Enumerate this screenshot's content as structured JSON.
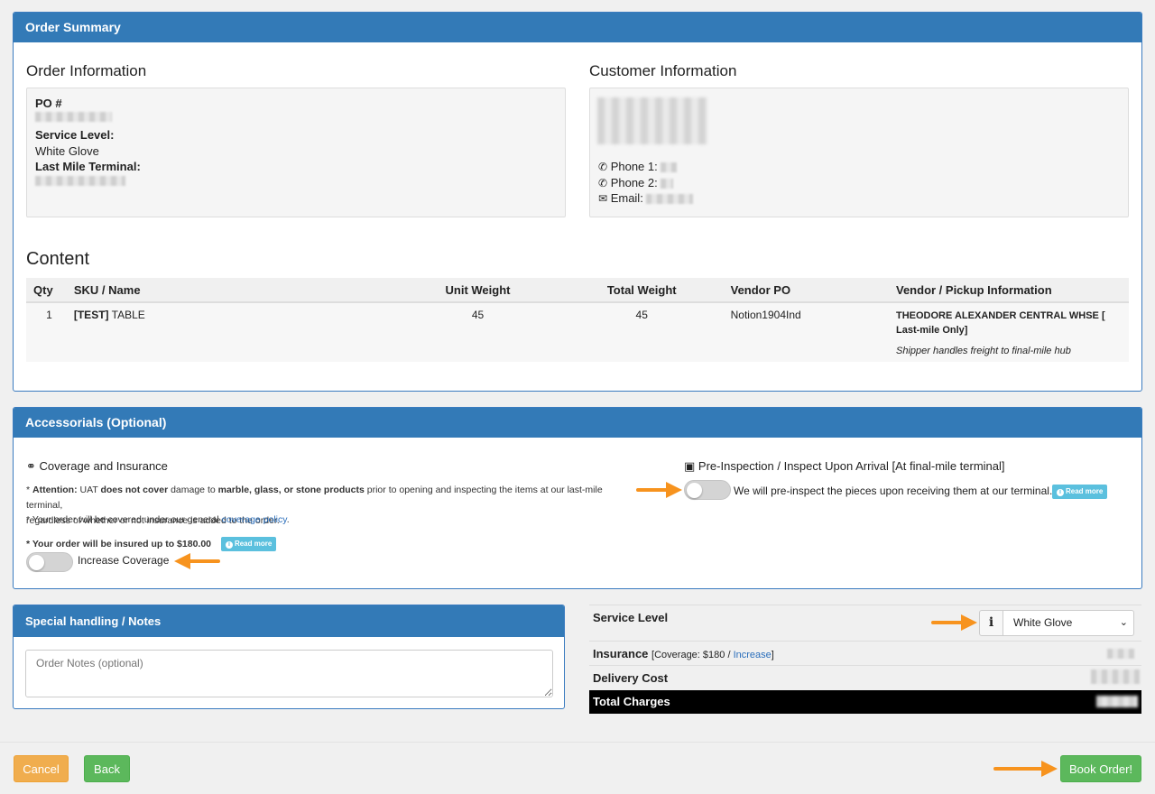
{
  "order_summary": {
    "title": "Order Summary",
    "order_info_title": "Order Information",
    "po_label": "PO #",
    "service_level_label": "Service Level:",
    "service_level_value": "White Glove",
    "terminal_label": "Last Mile Terminal:",
    "customer_info_title": "Customer Information",
    "phone1_label": "Phone 1:",
    "phone2_label": "Phone 2:",
    "email_label": "Email:"
  },
  "content": {
    "title": "Content",
    "headers": [
      "Qty",
      "SKU / Name",
      "Unit Weight",
      "Total Weight",
      "Vendor PO",
      "Vendor / Pickup Information"
    ],
    "row": {
      "qty": "1",
      "sku_tag": "[TEST]",
      "sku_name": "TABLE",
      "unit_weight": "45",
      "total_weight": "45",
      "vendor_po": "Notion1904Ind",
      "vendor_name": "THEODORE ALEXANDER CENTRAL WHSE [ Last-mile Only]",
      "vendor_note": "Shipper handles freight to final-mile hub"
    }
  },
  "accessorials": {
    "title": "Accessorials (Optional)",
    "coverage_title": "Coverage and Insurance",
    "attention_label": "Attention:",
    "attention_p1": "UAT",
    "attention_p2": "does not cover",
    "attention_p3": "damage to",
    "attention_p4": "marble, glass, or stone products",
    "attention_p5": "prior to opening and inspecting the items at our last-mile terminal,",
    "attention_p6": "regardless of whether or not insurance is added to the order.",
    "covered_text": "* Your order will be covered under our general",
    "coverage_link": "coverage policy",
    "insured_text": "* Your order will be insured up to $180.00",
    "read_more": "Read more",
    "increase_coverage": "Increase Coverage",
    "preinspect_title": "Pre-Inspection / Inspect Upon Arrival [At final-mile terminal]",
    "preinspect_text": "We will pre-inspect the pieces upon receiving them at our terminal."
  },
  "notes": {
    "title": "Special handling / Notes",
    "placeholder": "Order Notes (optional)"
  },
  "summary": {
    "service_level_label": "Service Level",
    "service_level_selected": "White Glove",
    "insurance_label": "Insurance",
    "insurance_coverage_prefix": "[Coverage: $180 /",
    "insurance_increase": "Increase",
    "insurance_suffix": "]",
    "delivery_cost_label": "Delivery Cost",
    "total_label": "Total Charges"
  },
  "footer": {
    "cancel": "Cancel",
    "back": "Back",
    "book": "Book Order!"
  },
  "colors": {
    "primary": "#337ab7",
    "success": "#5cb85c",
    "warning": "#f0ad4e",
    "info": "#5bc0de",
    "arrow": "#f7931e"
  }
}
